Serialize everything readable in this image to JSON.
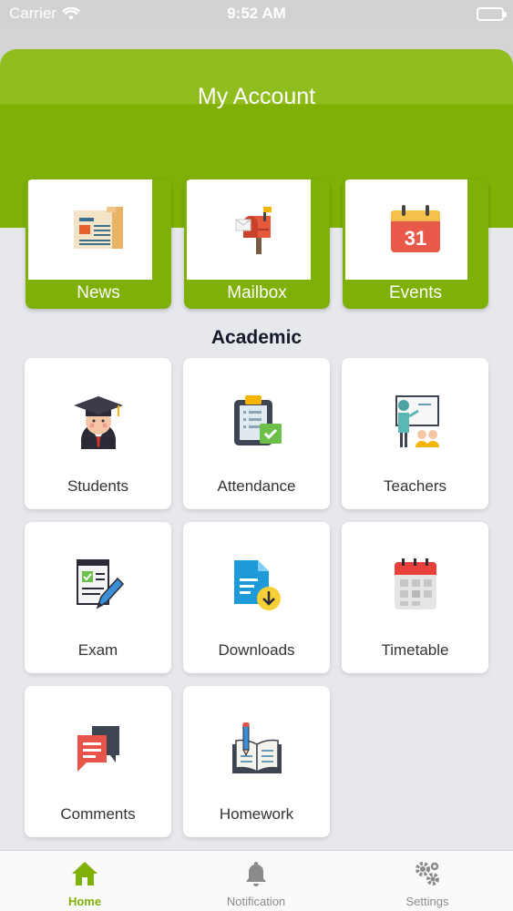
{
  "status": {
    "carrier": "Carrier",
    "time": "9:52 AM"
  },
  "header": {
    "title": "My Account"
  },
  "account": [
    {
      "label": "News",
      "icon": "newspaper-icon"
    },
    {
      "label": "Mailbox",
      "icon": "mailbox-icon"
    },
    {
      "label": "Events",
      "icon": "calendar-icon",
      "day": "31"
    }
  ],
  "section": {
    "title": "Academic"
  },
  "tiles": [
    {
      "label": "Students",
      "icon": "student-graduate-icon"
    },
    {
      "label": "Attendance",
      "icon": "clipboard-check-icon"
    },
    {
      "label": "Teachers",
      "icon": "teacher-board-icon"
    },
    {
      "label": "Exam",
      "icon": "exam-pencil-icon"
    },
    {
      "label": "Downloads",
      "icon": "download-document-icon"
    },
    {
      "label": "Timetable",
      "icon": "timetable-calendar-icon"
    },
    {
      "label": "Comments",
      "icon": "comments-icon"
    },
    {
      "label": "Homework",
      "icon": "homework-book-icon"
    }
  ],
  "tabbar": [
    {
      "label": "Home",
      "icon": "home-icon",
      "active": true
    },
    {
      "label": "Notification",
      "icon": "bell-icon",
      "active": false
    },
    {
      "label": "Settings",
      "icon": "gears-icon",
      "active": false
    }
  ],
  "colors": {
    "brand": "#7fb006",
    "brand_light": "#8fbd1d",
    "background": "#e6e8ec"
  }
}
